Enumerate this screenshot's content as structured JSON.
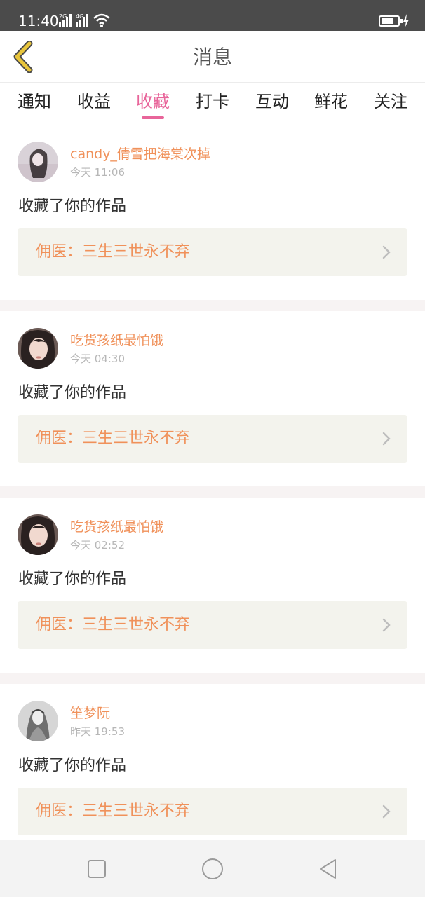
{
  "status_bar": {
    "time": "11:40",
    "sim1_tag": "2G",
    "sim2_tag": "4G",
    "icons": [
      "signal-icon",
      "signal-icon",
      "wifi-icon",
      "battery-icon",
      "charging-icon"
    ]
  },
  "header": {
    "title": "消息",
    "back_icon": "chevron-left-icon",
    "back_icon_color": "#e8c53c"
  },
  "tabs": [
    {
      "label": "通知"
    },
    {
      "label": "收益"
    },
    {
      "label": "收藏"
    },
    {
      "label": "打卡"
    },
    {
      "label": "互动"
    },
    {
      "label": "鲜花"
    },
    {
      "label": "关注"
    }
  ],
  "active_tab": "收藏",
  "colors": {
    "accent": "#e8659a",
    "username": "#f0915a",
    "work_title": "#f0915a",
    "work_bg": "#f3f3ed",
    "status_bar_bg": "#4b4b4b"
  },
  "feed": [
    {
      "username": "candy_倩雪把海棠次掉",
      "time": "今天 11:06",
      "action": "收藏了你的作品",
      "work_title": "佣医：三生三世永不弃",
      "avatar_icon": "user-avatar-photo"
    },
    {
      "username": "吃货孩纸最怕饿",
      "time": "今天 04:30",
      "action": "收藏了你的作品",
      "work_title": "佣医：三生三世永不弃",
      "avatar_icon": "user-avatar-photo"
    },
    {
      "username": "吃货孩纸最怕饿",
      "time": "今天 02:52",
      "action": "收藏了你的作品",
      "work_title": "佣医：三生三世永不弃",
      "avatar_icon": "user-avatar-photo"
    },
    {
      "username": "笙梦阮",
      "time": "昨天 19:53",
      "action": "收藏了你的作品",
      "work_title": "佣医：三生三世永不弃",
      "avatar_icon": "user-avatar-drawing"
    }
  ],
  "nav_bar": {
    "icons": [
      "square-recents-icon",
      "circle-home-icon",
      "triangle-back-icon"
    ]
  }
}
